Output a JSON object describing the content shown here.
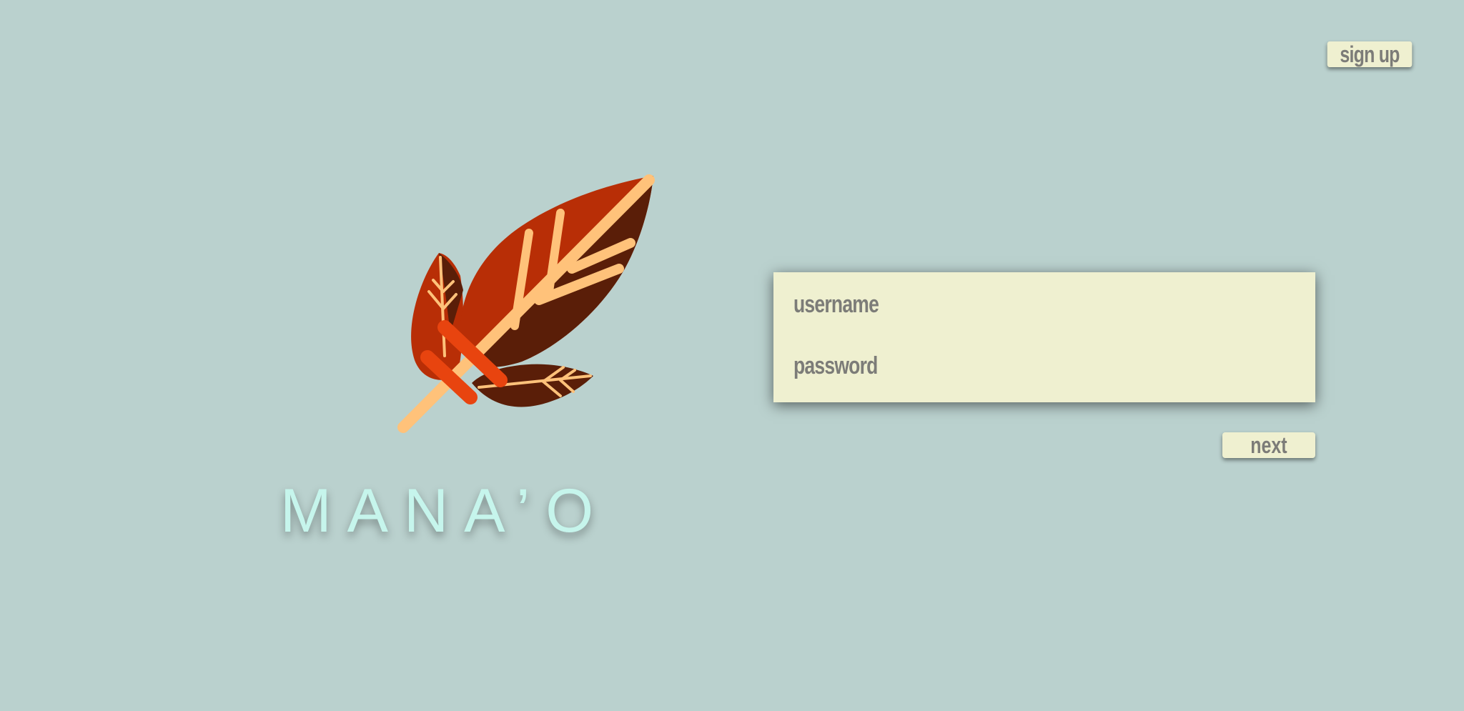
{
  "header": {
    "signup_label": "sign up"
  },
  "brand": {
    "name": "MANA’O",
    "logo_icon": "feather-leaf-logo-icon"
  },
  "login": {
    "username_placeholder": "username",
    "password_placeholder": "password",
    "username_value": "",
    "password_value": "",
    "next_label": "next"
  },
  "colors": {
    "background": "#bad1ce",
    "panel": "#eff0d0",
    "text_muted": "#7c7c78",
    "brand_text": "#c6f5ec",
    "leaf_dark": "#5a1e08",
    "leaf_red": "#b82e06",
    "leaf_orange": "#e8440f",
    "leaf_peach": "#ffc27a"
  }
}
